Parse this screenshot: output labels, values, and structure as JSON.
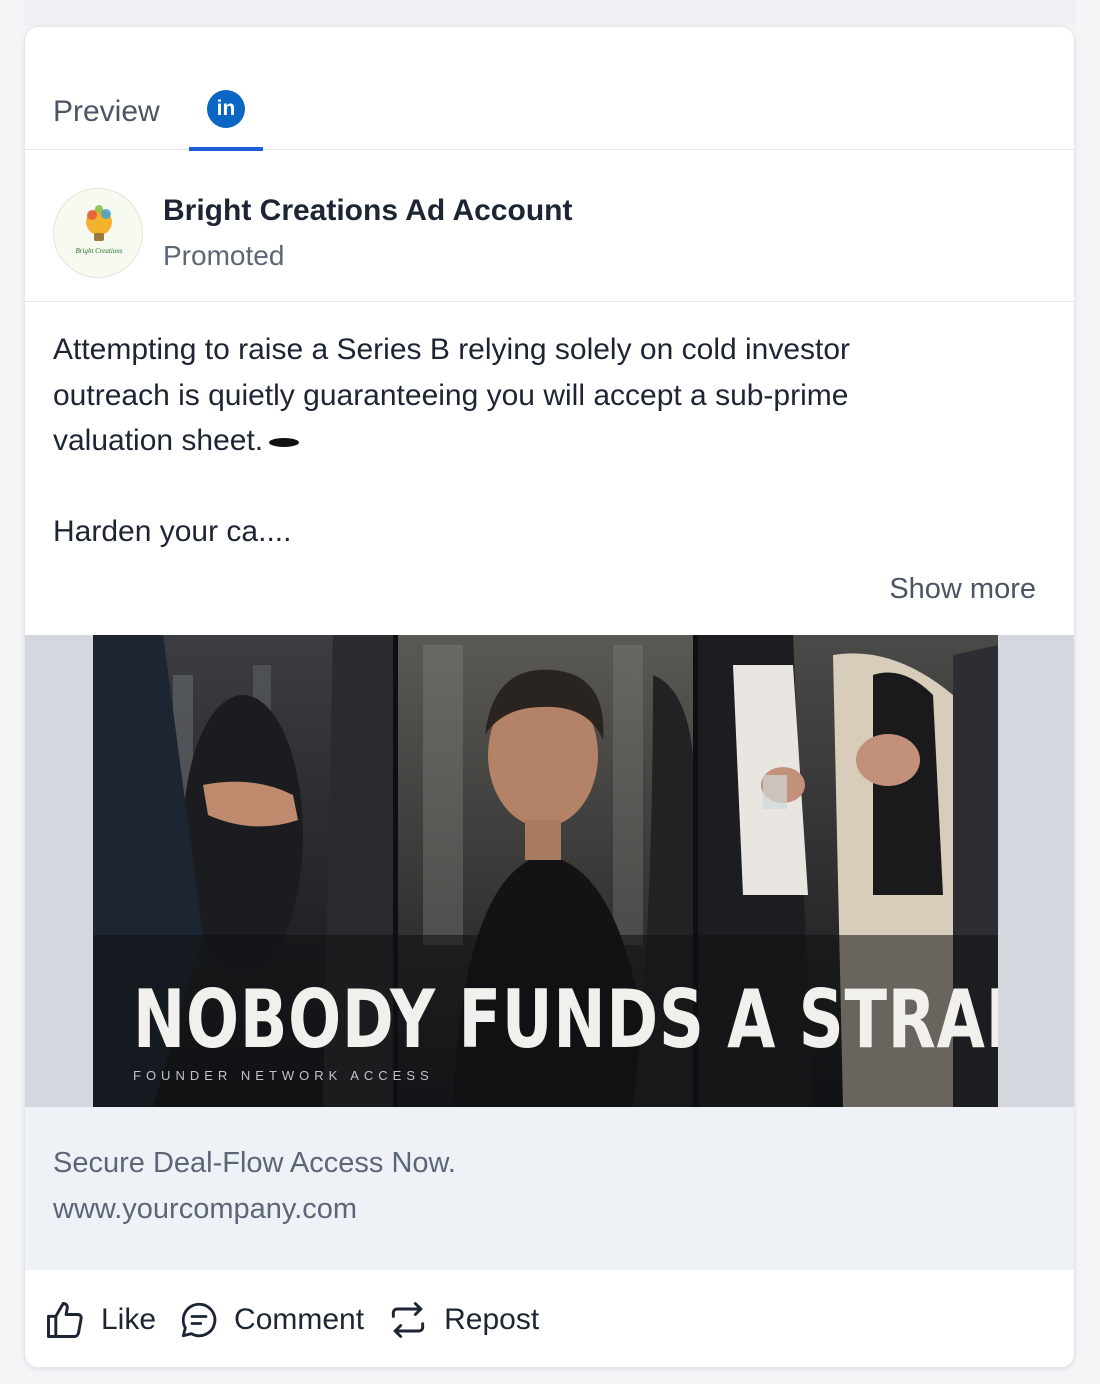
{
  "tabs": {
    "preview_label": "Preview",
    "linkedin_icon": "linkedin-icon",
    "linkedin_glyph": "in"
  },
  "author": {
    "name": "Bright Creations Ad Account",
    "subtitle": "Promoted",
    "avatar_logo_text": "Bright Creations"
  },
  "post": {
    "paragraph1": "Attempting to raise a Series B relying solely on cold investor\noutreach is quietly guaranteeing you will accept a sub-prime\nvaluation sheet.",
    "paragraph2": "Harden your ca....",
    "show_more": "Show more"
  },
  "creative": {
    "headline": "NOBODY FUNDS A STRANGER.",
    "subline": "FOUNDER NETWORK ACCESS"
  },
  "cta": {
    "title": "Secure Deal-Flow Access Now.",
    "url": "www.yourcompany.com"
  },
  "actions": {
    "like": "Like",
    "comment": "Comment",
    "repost": "Repost"
  },
  "colors": {
    "linkedin_blue": "#0a66c2",
    "tab_underline": "#1f5fd6",
    "cta_background": "#eef2f7"
  }
}
